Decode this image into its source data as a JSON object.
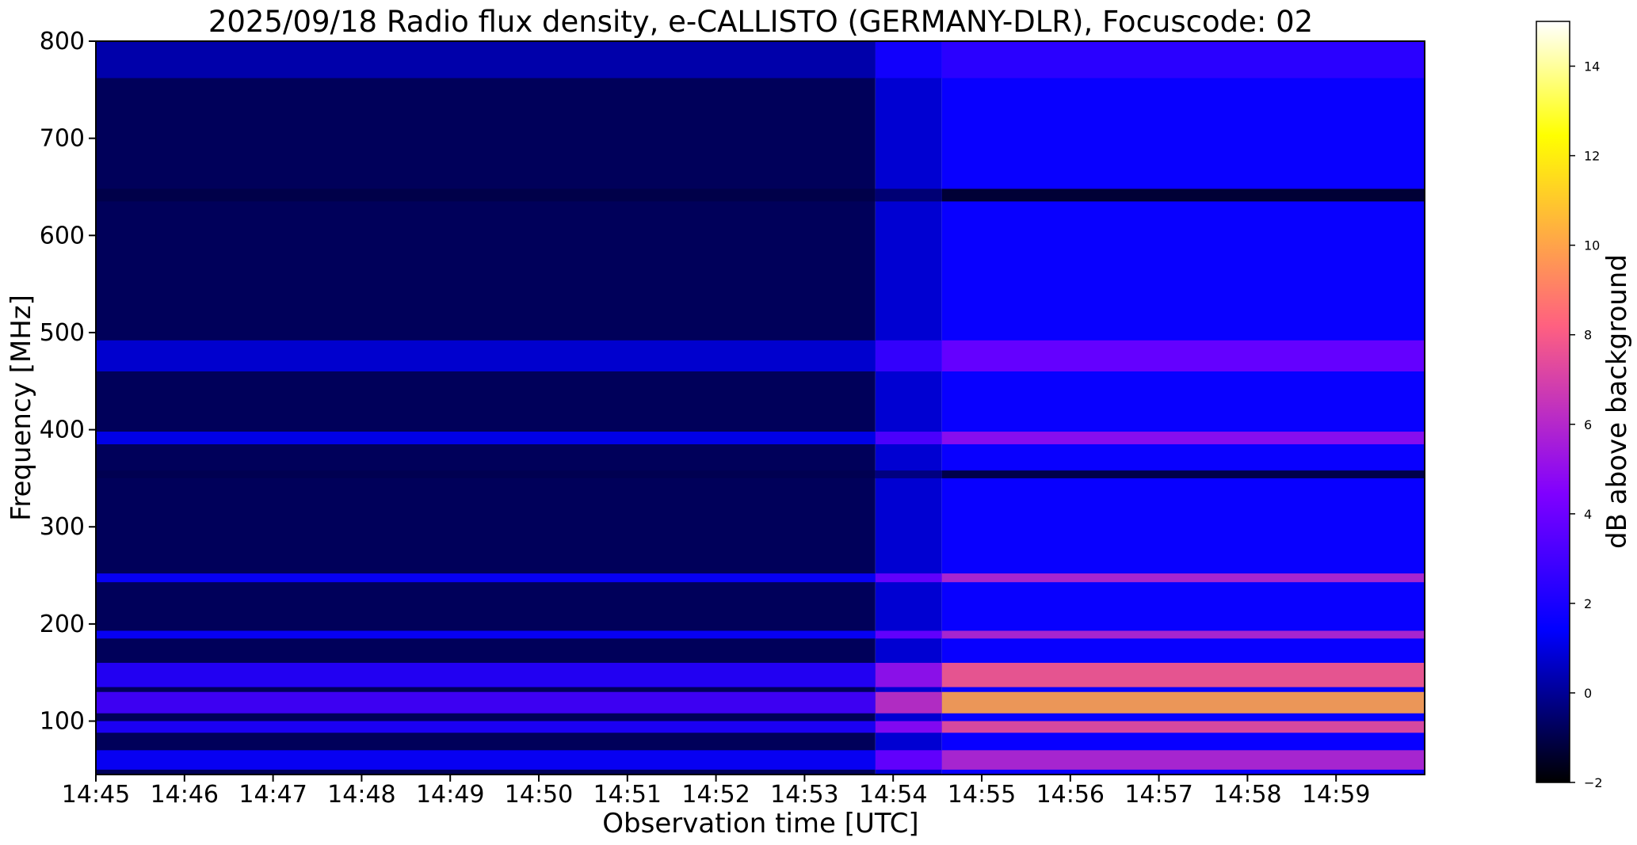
{
  "chart_data": {
    "type": "heatmap",
    "title": "2025/09/18  Radio flux density, e-CALLISTO (GERMANY-DLR), Focuscode: 02",
    "xlabel": "Observation time [UTC]",
    "ylabel": "Frequency [MHz]",
    "colorbar_label": "dB above background",
    "x_tick_labels": [
      "14:45",
      "14:46",
      "14:47",
      "14:48",
      "14:49",
      "14:50",
      "14:51",
      "14:52",
      "14:53",
      "14:54",
      "14:55",
      "14:56",
      "14:57",
      "14:58",
      "14:59"
    ],
    "x_tick_minutes": [
      0,
      1,
      2,
      3,
      4,
      5,
      6,
      7,
      8,
      9,
      10,
      11,
      12,
      13,
      14
    ],
    "xlim_minutes": [
      0,
      15
    ],
    "y_ticks": [
      100,
      200,
      300,
      400,
      500,
      600,
      700,
      800
    ],
    "ylim": [
      45,
      800
    ],
    "colorbar_ticks": [
      -2,
      0,
      2,
      4,
      6,
      8,
      10,
      12,
      14
    ],
    "colorbar_range": [
      -2,
      15
    ],
    "colormap": "gnuplot2",
    "colormap_stops": [
      "#000000",
      "#0000ff",
      "#8000ff",
      "#ff6080",
      "#ffff00",
      "#ffffff"
    ],
    "segments": [
      {
        "start_min": 0.0,
        "end_min": 8.8,
        "base_db": -0.8
      },
      {
        "start_min": 8.8,
        "end_min": 9.55,
        "base_db": 0.8
      },
      {
        "start_min": 9.55,
        "end_min": 15.0,
        "base_db": 1.6
      }
    ],
    "bands_mhz": [
      {
        "from": 762,
        "to": 800,
        "db": 2.5
      },
      {
        "from": 635,
        "to": 648,
        "db": -1.5
      },
      {
        "from": 460,
        "to": 492,
        "db": 4.0
      },
      {
        "from": 385,
        "to": 398,
        "db": 5.0
      },
      {
        "from": 350,
        "to": 358,
        "db": -1.2
      },
      {
        "from": 243,
        "to": 252,
        "db": 6.0
      },
      {
        "from": 185,
        "to": 193,
        "db": 6.0
      },
      {
        "from": 135,
        "to": 160,
        "db": 8.0
      },
      {
        "from": 108,
        "to": 130,
        "db": 10.0
      },
      {
        "from": 88,
        "to": 100,
        "db": 7.5
      },
      {
        "from": 50,
        "to": 70,
        "db": 6.0
      }
    ]
  }
}
